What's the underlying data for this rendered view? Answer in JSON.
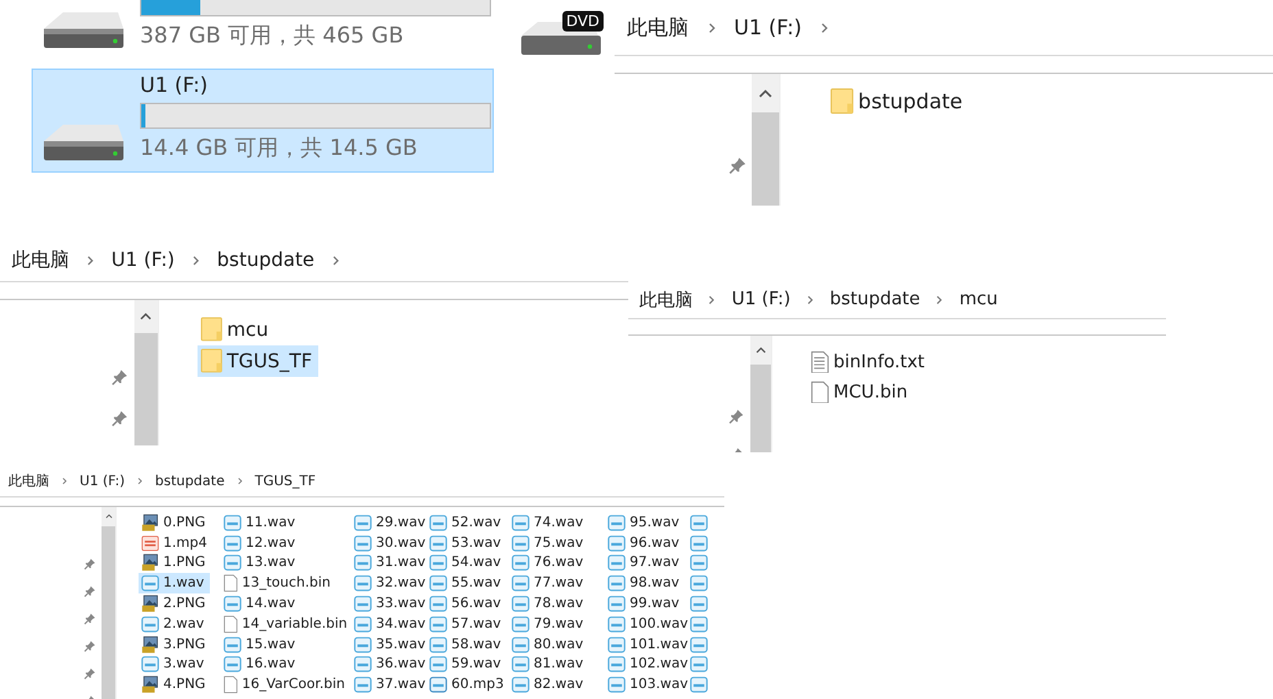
{
  "drives": [
    {
      "selected": false,
      "level": 0.17,
      "space": "387 GB 可用，共 465 GB"
    },
    {
      "name": "U1 (F:)",
      "selected": true,
      "level": 0.01,
      "space": "14.4 GB 可用，共 14.5 GB"
    }
  ],
  "dvd_drive": {
    "label": "DVD"
  },
  "windows": [
    {
      "breadcrumb": [
        "此电脑",
        "U1 (F:)"
      ],
      "trailing_chevron": true,
      "quick_access": [
        {
          "kind": "pin"
        }
      ],
      "columns": [
        [
          {
            "name": "bstupdate",
            "kind": "folder",
            "selected": false
          }
        ]
      ]
    },
    {
      "breadcrumb": [
        "此电脑",
        "U1 (F:)",
        "bstupdate"
      ],
      "trailing_chevron": true,
      "quick_access": [
        {
          "kind": "pin"
        },
        {
          "kind": "pin"
        }
      ],
      "columns": [
        [
          {
            "name": "mcu",
            "kind": "folder",
            "selected": false
          },
          {
            "name": "TGUS_TF",
            "kind": "folder",
            "selected": true
          }
        ]
      ]
    },
    {
      "breadcrumb": [
        "此电脑",
        "U1 (F:)",
        "bstupdate",
        "mcu"
      ],
      "trailing_chevron": false,
      "quick_access": [
        {
          "kind": "pin"
        },
        {
          "kind": "pin"
        }
      ],
      "columns": [
        [
          {
            "name": "binInfo.txt",
            "kind": "txt",
            "selected": false
          },
          {
            "name": "MCU.bin",
            "kind": "bin",
            "selected": false
          }
        ]
      ]
    },
    {
      "breadcrumb": [
        "此电脑",
        "U1 (F:)",
        "bstupdate",
        "TGUS_TF"
      ],
      "trailing_chevron": false,
      "quick_access": [
        {
          "kind": "pin"
        },
        {
          "kind": "pin"
        },
        {
          "kind": "pin"
        },
        {
          "kind": "pin"
        },
        {
          "kind": "pin"
        },
        {
          "kind": "pin"
        }
      ],
      "columns": [
        [
          {
            "name": "0.PNG",
            "kind": "png",
            "selected": false
          },
          {
            "name": "1.mp4",
            "kind": "mp4",
            "selected": false
          },
          {
            "name": "1.PNG",
            "kind": "png",
            "selected": false
          },
          {
            "name": "1.wav",
            "kind": "wav",
            "selected": true
          },
          {
            "name": "2.PNG",
            "kind": "png",
            "selected": false
          },
          {
            "name": "2.wav",
            "kind": "wav",
            "selected": false
          },
          {
            "name": "3.PNG",
            "kind": "png",
            "selected": false
          },
          {
            "name": "3.wav",
            "kind": "wav",
            "selected": false
          },
          {
            "name": "4.PNG",
            "kind": "png",
            "selected": false
          }
        ],
        [
          {
            "name": "11.wav",
            "kind": "wav",
            "selected": false
          },
          {
            "name": "12.wav",
            "kind": "wav",
            "selected": false
          },
          {
            "name": "13.wav",
            "kind": "wav",
            "selected": false
          },
          {
            "name": "13_touch.bin",
            "kind": "bin",
            "selected": false
          },
          {
            "name": "14.wav",
            "kind": "wav",
            "selected": false
          },
          {
            "name": "14_variable.bin",
            "kind": "bin",
            "selected": false
          },
          {
            "name": "15.wav",
            "kind": "wav",
            "selected": false
          },
          {
            "name": "16.wav",
            "kind": "wav",
            "selected": false
          },
          {
            "name": "16_VarCoor.bin",
            "kind": "bin",
            "selected": false
          }
        ],
        [
          {
            "name": "29.wav",
            "kind": "wav",
            "selected": false
          },
          {
            "name": "30.wav",
            "kind": "wav",
            "selected": false
          },
          {
            "name": "31.wav",
            "kind": "wav",
            "selected": false
          },
          {
            "name": "32.wav",
            "kind": "wav",
            "selected": false
          },
          {
            "name": "33.wav",
            "kind": "wav",
            "selected": false
          },
          {
            "name": "34.wav",
            "kind": "wav",
            "selected": false
          },
          {
            "name": "35.wav",
            "kind": "wav",
            "selected": false
          },
          {
            "name": "36.wav",
            "kind": "wav",
            "selected": false
          },
          {
            "name": "37.wav",
            "kind": "wav",
            "selected": false
          }
        ],
        [
          {
            "name": "52.wav",
            "kind": "wav",
            "selected": false
          },
          {
            "name": "53.wav",
            "kind": "wav",
            "selected": false
          },
          {
            "name": "54.wav",
            "kind": "wav",
            "selected": false
          },
          {
            "name": "55.wav",
            "kind": "wav",
            "selected": false
          },
          {
            "name": "56.wav",
            "kind": "wav",
            "selected": false
          },
          {
            "name": "57.wav",
            "kind": "wav",
            "selected": false
          },
          {
            "name": "58.wav",
            "kind": "wav",
            "selected": false
          },
          {
            "name": "59.wav",
            "kind": "wav",
            "selected": false
          },
          {
            "name": "60.mp3",
            "kind": "mp3",
            "selected": false
          }
        ],
        [
          {
            "name": "74.wav",
            "kind": "wav",
            "selected": false
          },
          {
            "name": "75.wav",
            "kind": "wav",
            "selected": false
          },
          {
            "name": "76.wav",
            "kind": "wav",
            "selected": false
          },
          {
            "name": "77.wav",
            "kind": "wav",
            "selected": false
          },
          {
            "name": "78.wav",
            "kind": "wav",
            "selected": false
          },
          {
            "name": "79.wav",
            "kind": "wav",
            "selected": false
          },
          {
            "name": "80.wav",
            "kind": "wav",
            "selected": false
          },
          {
            "name": "81.wav",
            "kind": "wav",
            "selected": false
          },
          {
            "name": "82.wav",
            "kind": "wav",
            "selected": false
          }
        ],
        [
          {
            "name": "95.wav",
            "kind": "wav",
            "selected": false
          },
          {
            "name": "96.wav",
            "kind": "wav",
            "selected": false
          },
          {
            "name": "97.wav",
            "kind": "wav",
            "selected": false
          },
          {
            "name": "98.wav",
            "kind": "wav",
            "selected": false
          },
          {
            "name": "99.wav",
            "kind": "wav",
            "selected": false
          },
          {
            "name": "100.wav",
            "kind": "wav",
            "selected": false
          },
          {
            "name": "101.wav",
            "kind": "wav",
            "selected": false
          },
          {
            "name": "102.wav",
            "kind": "wav",
            "selected": false
          },
          {
            "name": "103.wav",
            "kind": "wav",
            "selected": false
          }
        ],
        [
          {
            "kind": "wav",
            "selected": false
          },
          {
            "kind": "wav",
            "selected": false
          },
          {
            "kind": "wav",
            "selected": false
          },
          {
            "kind": "wav",
            "selected": false
          },
          {
            "kind": "wav",
            "selected": false
          },
          {
            "kind": "wav",
            "selected": false
          },
          {
            "kind": "wav",
            "selected": false
          },
          {
            "kind": "wav",
            "selected": false
          },
          {
            "kind": "wav",
            "selected": false
          }
        ]
      ]
    }
  ]
}
